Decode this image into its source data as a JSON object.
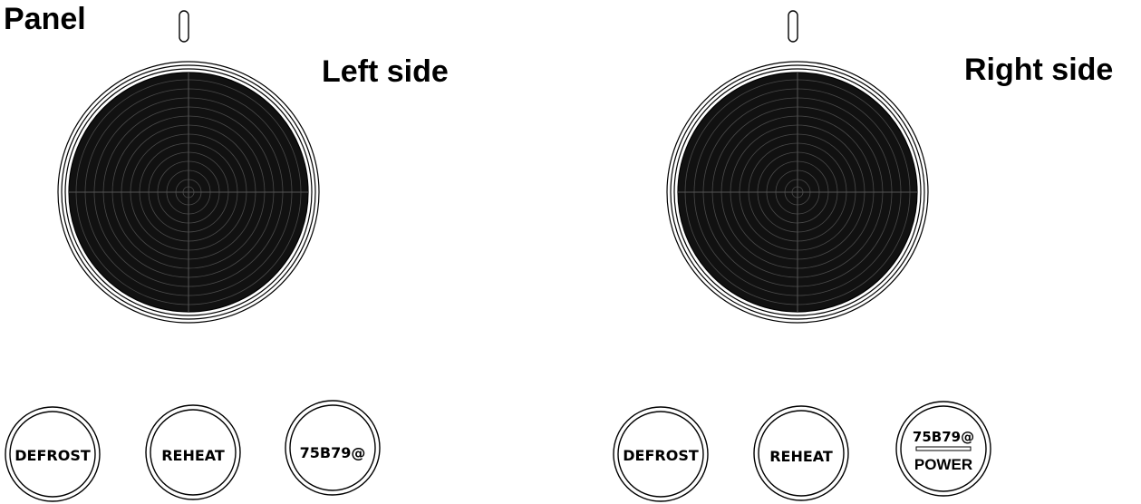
{
  "title": "Panel",
  "sides": [
    {
      "label": "Left side",
      "buttons": [
        {
          "label": "DEFROST"
        },
        {
          "label": "REHEAT"
        },
        {
          "label": "75B79@"
        }
      ]
    },
    {
      "label": "Right side",
      "buttons": [
        {
          "label": "DEFROST"
        },
        {
          "label": "REHEAT"
        },
        {
          "label": "75B79@",
          "sublabel": "POWER"
        }
      ]
    }
  ]
}
